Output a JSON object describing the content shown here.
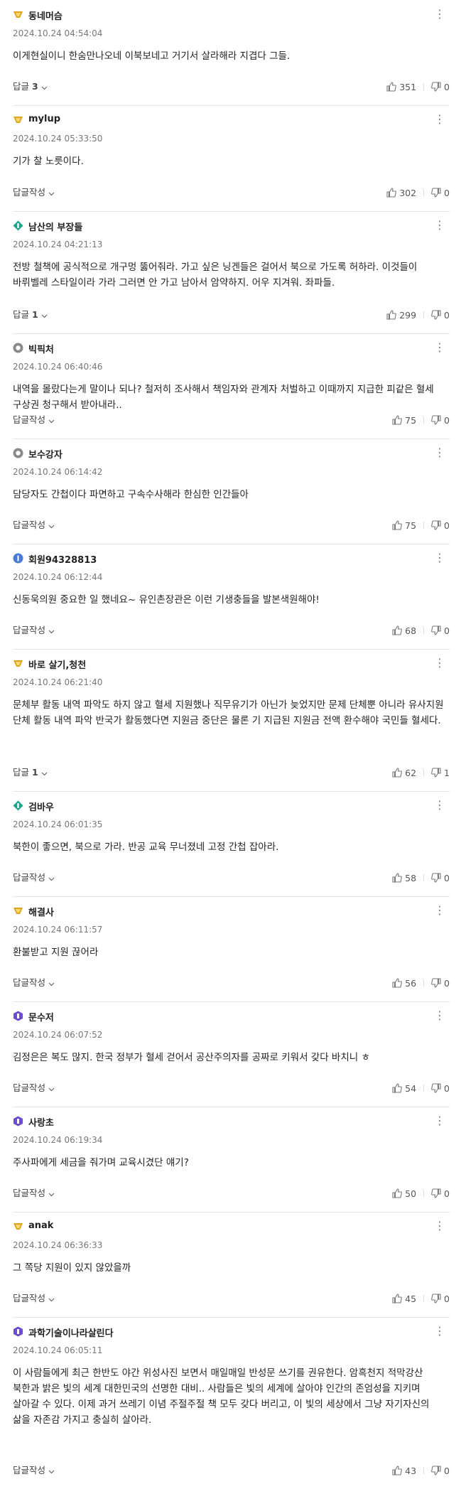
{
  "colors": {
    "gold": "#e0a31c",
    "teal": "#1aa38f",
    "blue": "#4a7bd6",
    "purple": "#6b4ad6",
    "gray": "#8a8a8a"
  },
  "comments": [
    {
      "nick": "동네머슴",
      "badge": "gold",
      "date": "2024.10.24 04:54:04",
      "text": "이게현실이니 한숨만나오네 이북보네고 거기서 살라해라 지겹다 그들.",
      "reply_label": "답글",
      "reply_count": "3",
      "likes": "351",
      "dislikes": "0"
    },
    {
      "nick": "mylup",
      "badge": "gold",
      "date": "2024.10.24 05:33:50",
      "text": "기가 찰 노릇이다.",
      "reply_label": "답글작성",
      "reply_count": "",
      "likes": "302",
      "dislikes": "0"
    },
    {
      "nick": "남산의 부장들",
      "badge": "teal",
      "date": "2024.10.24 04:21:13",
      "text": "전방 철책에 공식적으로 개구멍 뚫어줘라. 가고 싶은 닝겐들은 걸어서 북으로 가도록 허하라. 이것들이 바뤼벨레 스타일이라 가라 그러면 안 가고 남아서 암약하지. 어우 지겨워. 좌파들.",
      "reply_label": "답글",
      "reply_count": "1",
      "likes": "299",
      "dislikes": "0"
    },
    {
      "nick": "빅픽처",
      "badge": "gray",
      "date": "2024.10.24 06:40:46",
      "text": "내역을 몰랐다는게 말이나 되나? 철저히 조사해서 책임자와 관계자 처벌하고 이때까지 지급한 피같은 혈세 구상권 청구해서 받아내라..",
      "reply_label": "답글작성",
      "reply_count": "",
      "likes": "75",
      "dislikes": "0"
    },
    {
      "nick": "보수강자",
      "badge": "gray",
      "date": "2024.10.24 06:14:42",
      "text": "담당자도 간첩이다 파면하고 구속수사해라 한심한 인간들아",
      "reply_label": "답글작성",
      "reply_count": "",
      "likes": "75",
      "dislikes": "0"
    },
    {
      "nick": "회원94328813",
      "badge": "blue",
      "date": "2024.10.24 06:12:44",
      "text": "신동욱의원 중요한 일 했네요~ 유인촌장관은 이런 기생충들을 발본색원해야!",
      "reply_label": "답글작성",
      "reply_count": "",
      "likes": "68",
      "dislikes": "0"
    },
    {
      "nick": "바로 살기,청천",
      "badge": "gold",
      "date": "2024.10.24 06:21:40",
      "text": "문체부 활동 내역 파악도 하지 않고 혈세 지원했나 직무유기가 아닌가 늦었지만 문제 단체뿐 아니라 유사지원 단체 활동 내역 파악 반국가 활동했다면 지원금 중단은 물론 기 지급된 지원금 전액 환수해야 국민들 혈세다.",
      "reply_label": "답글",
      "reply_count": "1",
      "likes": "62",
      "dislikes": "1"
    },
    {
      "nick": "검바우",
      "badge": "teal",
      "date": "2024.10.24 06:01:35",
      "text": "북한이 좋으면, 북으로 가라. 반공 교육 무너졌네 고정 간첩 잡아라.",
      "reply_label": "답글작성",
      "reply_count": "",
      "likes": "58",
      "dislikes": "0"
    },
    {
      "nick": "해결사",
      "badge": "gold",
      "date": "2024.10.24 06:11:57",
      "text": "환불받고 지원 끊어라",
      "reply_label": "답글작성",
      "reply_count": "",
      "likes": "56",
      "dislikes": "0"
    },
    {
      "nick": "문수저",
      "badge": "purple",
      "date": "2024.10.24 06:07:52",
      "text": "김정은은 복도 많지. 한국 정부가 혈세 걷어서 공산주의자를 공짜로 키워서 갖다 바치니 ㅎ",
      "reply_label": "답글작성",
      "reply_count": "",
      "likes": "54",
      "dislikes": "0"
    },
    {
      "nick": "사랑초",
      "badge": "purple",
      "date": "2024.10.24 06:19:34",
      "text": "주사파에게 세금을 줘가며 교육시겼단 얘기?",
      "reply_label": "답글작성",
      "reply_count": "",
      "likes": "50",
      "dislikes": "0"
    },
    {
      "nick": "anak",
      "badge": "gold",
      "date": "2024.10.24 06:36:33",
      "text": "그 쪽당 지원이 있지 않았을까",
      "reply_label": "답글작성",
      "reply_count": "",
      "likes": "45",
      "dislikes": "0"
    },
    {
      "nick": "과학기술이나라살린다",
      "badge": "purple",
      "date": "2024.10.24 06:05:11",
      "text": "이 사람들에게 최근 한반도 야간 위성사진 보면서 매일매일 반성문 쓰기를 권유한다. 암흑천지 적막강산 북한과 밝은 빛의 세계 대한민국의 선명한 대비.. 사람들은 빛의 세계에 살아야 인간의 존엄성을 지키며 살아갈 수 있다. 이제 과거 쓰레기 이념 주절주절 책 모두 갖다 버리고, 이 빛의 세상에서 그냥 자기자신의 삶을 자존감 가지고 충실히 살아라.",
      "reply_label": "답글작성",
      "reply_count": "",
      "likes": "43",
      "dislikes": "0"
    }
  ]
}
